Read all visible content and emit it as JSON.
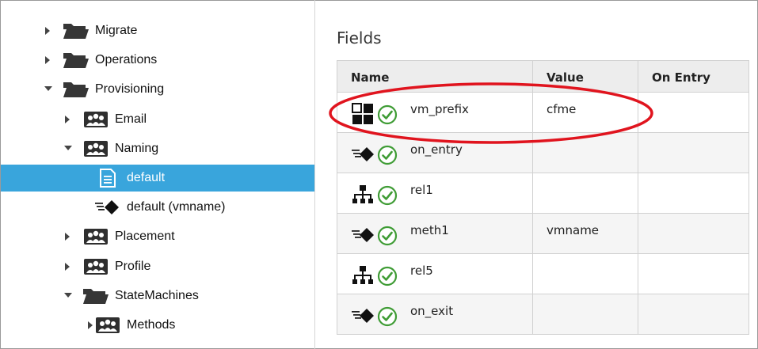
{
  "tree": {
    "items": [
      {
        "label": "Migrate",
        "icon": "folder-icon",
        "state": "collapsed",
        "level": 0
      },
      {
        "label": "Operations",
        "icon": "folder-icon",
        "state": "collapsed",
        "level": 0
      },
      {
        "label": "Provisioning",
        "icon": "folder-icon",
        "state": "expanded",
        "level": 0
      },
      {
        "label": "Email",
        "icon": "class-icon",
        "state": "collapsed",
        "level": 1
      },
      {
        "label": "Naming",
        "icon": "class-icon",
        "state": "expanded",
        "level": 1
      },
      {
        "label": "default",
        "icon": "instance-icon",
        "state": "leaf",
        "level": 2,
        "selected": true
      },
      {
        "label": "default (vmname)",
        "icon": "method-icon",
        "state": "leaf",
        "level": 2
      },
      {
        "label": "Placement",
        "icon": "class-icon",
        "state": "collapsed",
        "level": 1
      },
      {
        "label": "Profile",
        "icon": "class-icon",
        "state": "collapsed",
        "level": 1
      },
      {
        "label": "StateMachines",
        "icon": "folder-icon",
        "state": "expanded",
        "level": 1
      },
      {
        "label": "Methods",
        "icon": "class-icon",
        "state": "collapsed",
        "level": 2
      }
    ]
  },
  "fields": {
    "title": "Fields",
    "columns": [
      "Name",
      "Value",
      "On Entry"
    ],
    "rows": [
      {
        "icon": "attribute-icon",
        "status": "check-icon",
        "name": "vm_prefix",
        "value": "cfme",
        "on_entry": ""
      },
      {
        "icon": "method-icon",
        "status": "check-icon",
        "name": "on_entry",
        "value": "",
        "on_entry": ""
      },
      {
        "icon": "relationship-icon",
        "status": "check-icon",
        "name": "rel1",
        "value": "",
        "on_entry": ""
      },
      {
        "icon": "method-icon",
        "status": "check-icon",
        "name": "meth1",
        "value": "vmname",
        "on_entry": ""
      },
      {
        "icon": "relationship-icon",
        "status": "check-icon",
        "name": "rel5",
        "value": "",
        "on_entry": ""
      },
      {
        "icon": "method-icon",
        "status": "check-icon",
        "name": "on_exit",
        "value": "",
        "on_entry": ""
      }
    ]
  },
  "colors": {
    "selected": "#39a5dc",
    "check": "#3f9c35",
    "annotation": "#e0141e"
  }
}
